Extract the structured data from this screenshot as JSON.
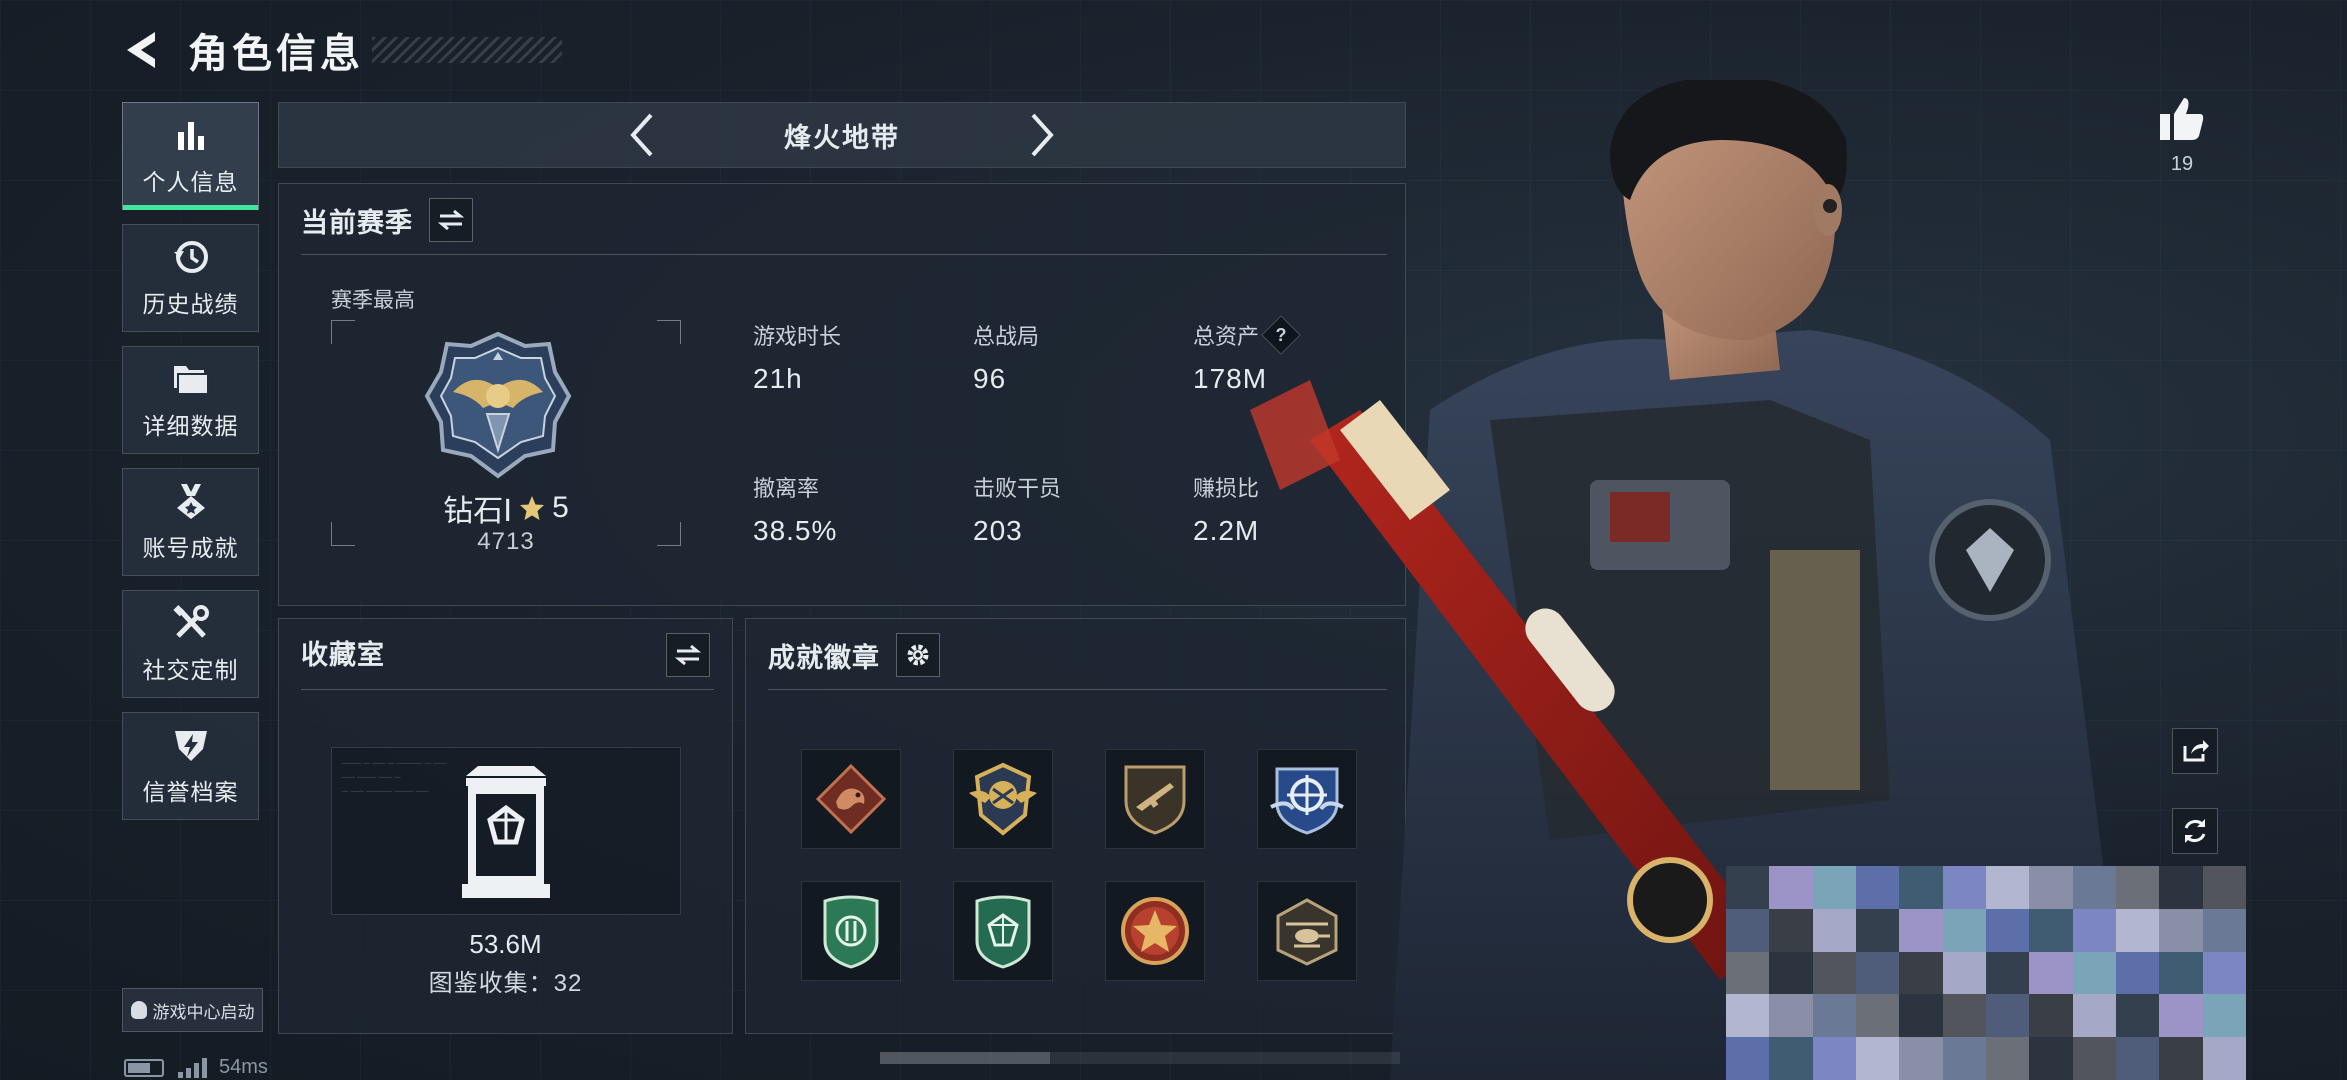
{
  "header": {
    "title": "角色信息"
  },
  "sidebar": {
    "items": [
      {
        "label": "个人信息",
        "icon": "bar-chart-icon",
        "active": true
      },
      {
        "label": "历史战绩",
        "icon": "history-icon"
      },
      {
        "label": "详细数据",
        "icon": "folder-icon"
      },
      {
        "label": "账号成就",
        "icon": "medal-icon"
      },
      {
        "label": "社交定制",
        "icon": "tools-icon"
      },
      {
        "label": "信誉档案",
        "icon": "shield-bolt-icon"
      }
    ],
    "launch_label": "游戏中心启动"
  },
  "status": {
    "ping": "54ms"
  },
  "game_tabs": {
    "current": "烽火地带"
  },
  "season": {
    "title": "当前赛季",
    "sub_label": "赛季最高",
    "rank": {
      "name": "钻石Ⅰ",
      "stars": "5",
      "score": "4713"
    },
    "stats": [
      {
        "label": "游戏时长",
        "value": "21h"
      },
      {
        "label": "总战局",
        "value": "96"
      },
      {
        "label": "总资产",
        "value": "178M",
        "help": "?"
      },
      {
        "label": "撤离率",
        "value": "38.5%"
      },
      {
        "label": "击败干员",
        "value": "203"
      },
      {
        "label": "赚损比",
        "value": "2.2M"
      }
    ]
  },
  "collection": {
    "title": "收藏室",
    "value": "53.6M",
    "count_text": "图鉴收集：32"
  },
  "achievements": {
    "title": "成就徽章",
    "badges": [
      {
        "icon": "dragon-badge-icon",
        "color": "#b5523a"
      },
      {
        "icon": "wings-gold-badge-icon",
        "color": "#c7a24b"
      },
      {
        "icon": "rifle-shield-badge-icon",
        "color": "#b49a6a"
      },
      {
        "icon": "crosshair-blue-badge-icon",
        "color": "#2f5ea8"
      },
      {
        "icon": "green-shield-badge-icon",
        "color": "#2f7d55"
      },
      {
        "icon": "green-gem-badge-icon",
        "color": "#2b7a5c"
      },
      {
        "icon": "star-medal-badge-icon",
        "color": "#b84a33"
      },
      {
        "icon": "helicopter-badge-icon",
        "color": "#8d7a5a"
      }
    ]
  },
  "likes": {
    "count": "19"
  },
  "colors": {
    "accent": "#41e6a0",
    "background": "#1b2430"
  }
}
